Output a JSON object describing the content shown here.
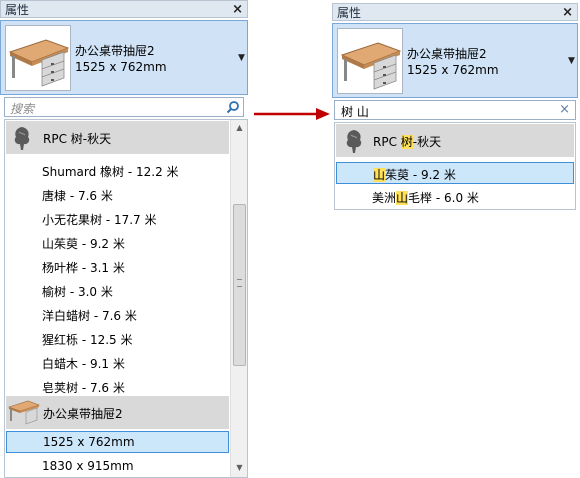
{
  "left_panel": {
    "title": "属性",
    "close_icon": "×",
    "type_name": "办公桌带抽屉2",
    "type_size": "1525 x 762mm",
    "search_placeholder": "搜索",
    "groups": [
      {
        "label": "RPC 树-秋天",
        "icon": "tree-icon"
      },
      {
        "label": "办公桌带抽屉2",
        "icon": "desk-icon"
      }
    ],
    "tree_items": [
      "Shumard 橡树 - 12.2 米",
      "唐棣 - 7.6 米",
      "小无花果树 - 17.7 米",
      "山茱萸 - 9.2 米",
      "杨叶桦 - 3.1 米",
      "榆树 - 3.0 米",
      "洋白蜡树 - 7.6 米",
      "猩红栎 - 12.5 米",
      "白蜡木 - 9.1 米",
      "皂荚树 - 7.6 米"
    ],
    "desk_items": [
      "1525 x 762mm",
      "1830 x 915mm"
    ]
  },
  "right_panel": {
    "title": "属性",
    "close_icon": "×",
    "type_name": "办公桌带抽屉2",
    "type_size": "1525 x 762mm",
    "search_value": "树 山",
    "clear_icon": "×",
    "group": {
      "prefix": "RPC ",
      "highlight": "树",
      "suffix": "-秋天"
    },
    "results": [
      {
        "before": "",
        "highlight": "山",
        "after": "茱萸 - 9.2 米"
      },
      {
        "before": "美洲",
        "highlight": "山",
        "after": "毛榉 - 6.0 米"
      }
    ]
  },
  "colors": {
    "arrow": "#c00000",
    "highlight": "#ffe15c",
    "selection": "#cce6fa"
  }
}
